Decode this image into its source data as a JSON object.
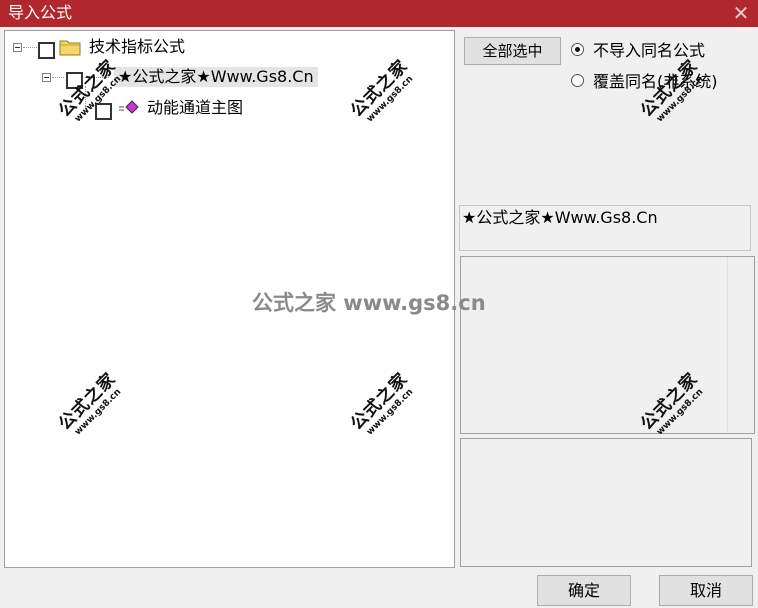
{
  "dialog": {
    "title": "导入公式",
    "close_symbol": "✕"
  },
  "tree": {
    "root": {
      "label": "技术指标公式",
      "icon": "folder-icon"
    },
    "child": {
      "label": "★公式之家★Www.Gs8.Cn"
    },
    "leaf": {
      "label": "动能通道主图",
      "icon": "formula-icon"
    }
  },
  "options": {
    "select_all_label": "全部选中",
    "radio_no_import_label": "不导入同名公式",
    "radio_no_import_checked": true,
    "radio_overwrite_label": "覆盖同名(非系统)",
    "radio_overwrite_checked": false
  },
  "info": {
    "source_text": "★公式之家★Www.Gs8.Cn"
  },
  "footer": {
    "ok_label": "确定",
    "cancel_label": "取消"
  },
  "watermark": {
    "cn": "公式之家",
    "url": "www.gs8.cn",
    "center_text": "公式之家 www.gs8.cn"
  },
  "colors": {
    "titlebar": "#b0272e",
    "window_bg": "#f0f0f0"
  }
}
